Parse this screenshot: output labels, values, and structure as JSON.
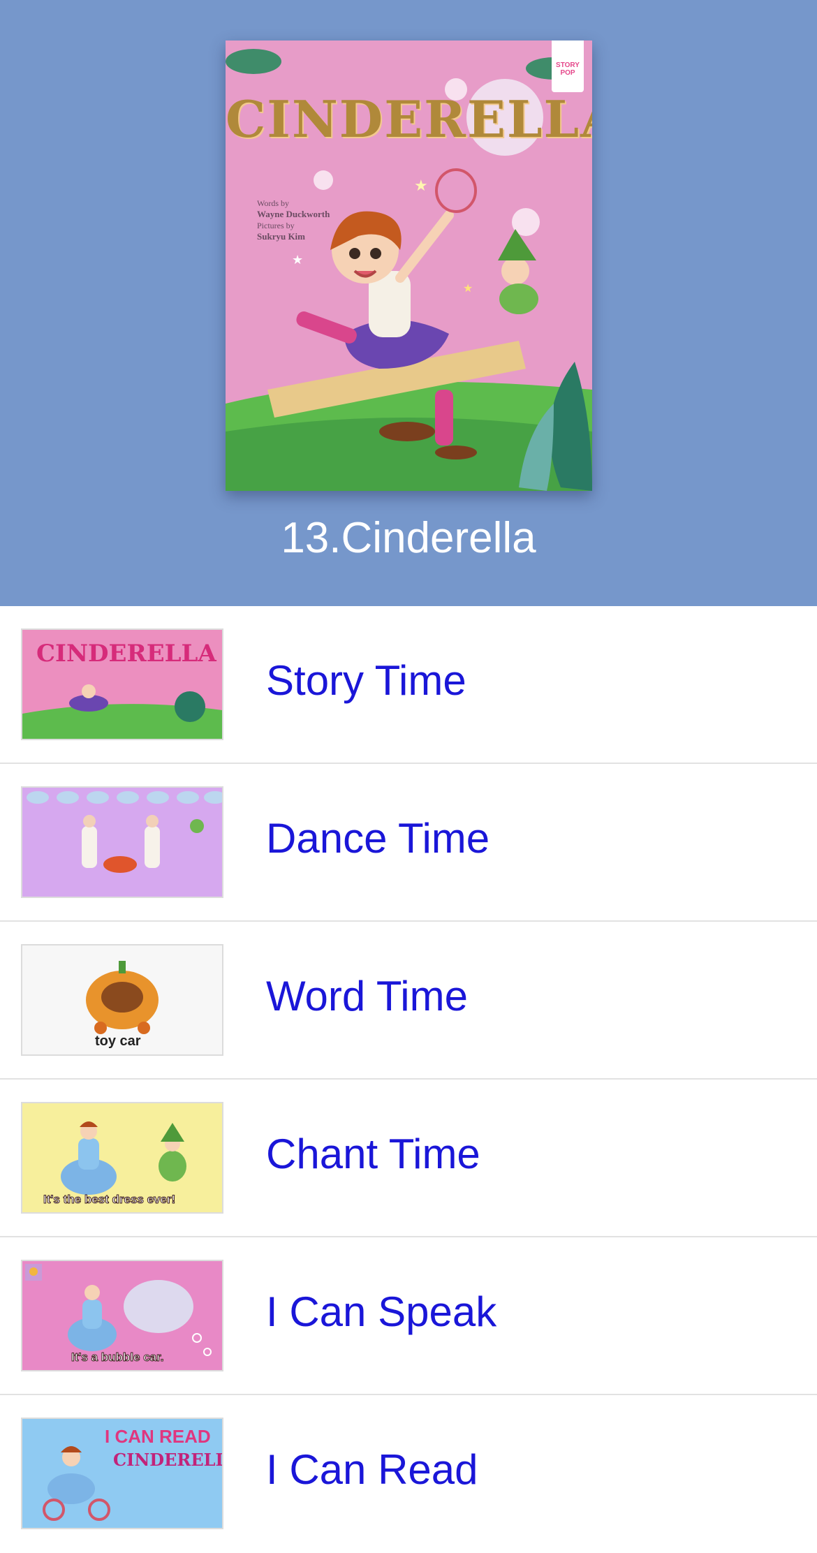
{
  "cover": {
    "title": "CINDERELLA",
    "words_by_label": "Words by",
    "author": "Wayne Duckworth",
    "pictures_by_label": "Pictures by",
    "illustrator": "Sukryu Kim",
    "logo_line1": "STORY",
    "logo_line2": "POP"
  },
  "book_title": "13.Cinderella",
  "menu_items": [
    {
      "label": "Story Time",
      "thumb_text": "CINDERELLA"
    },
    {
      "label": "Dance Time",
      "thumb_text": ""
    },
    {
      "label": "Word Time",
      "thumb_text": "toy car"
    },
    {
      "label": "Chant Time",
      "thumb_text": "It's the best dress ever!"
    },
    {
      "label": "I Can Speak",
      "thumb_text": "It's a bubble car."
    },
    {
      "label": "I Can Read",
      "thumb_text": "I CAN READ",
      "thumb_text_2": "CINDERELLA"
    }
  ],
  "colors": {
    "header_bg": "#7697cb",
    "label_color": "#1a16d8",
    "divider": "#e2e2e2"
  }
}
